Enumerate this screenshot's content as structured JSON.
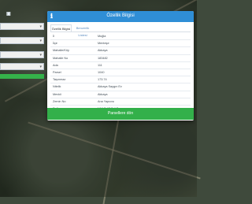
{
  "modal": {
    "title": "Özellik Bilgisi",
    "tabs": [
      "Özellik Bilgisi",
      "Benzerlik Listesi"
    ],
    "rows": [
      {
        "label": "İl",
        "value": "Muğla"
      },
      {
        "label": "İlçe",
        "value": "Menteşe"
      },
      {
        "label": "Mahalle/Köy",
        "value": "Akkaya"
      },
      {
        "label": "Mahalle No",
        "value": "183482"
      },
      {
        "label": "Ada",
        "value": "111"
      },
      {
        "label": "Parsel",
        "value": "1040"
      },
      {
        "label": "Taşınmaz",
        "value": "173.74"
      },
      {
        "label": "Nitelik",
        "value": "Akkaya Saygın Ev"
      },
      {
        "label": "Mevkii",
        "value": "Akkaya"
      },
      {
        "label": "Zemin No",
        "value": "Ana Yapıcısı"
      },
      {
        "label": "Pafta",
        "value": "N19 D 67 B 4 D"
      }
    ],
    "button_label": "Parsellere dön"
  }
}
